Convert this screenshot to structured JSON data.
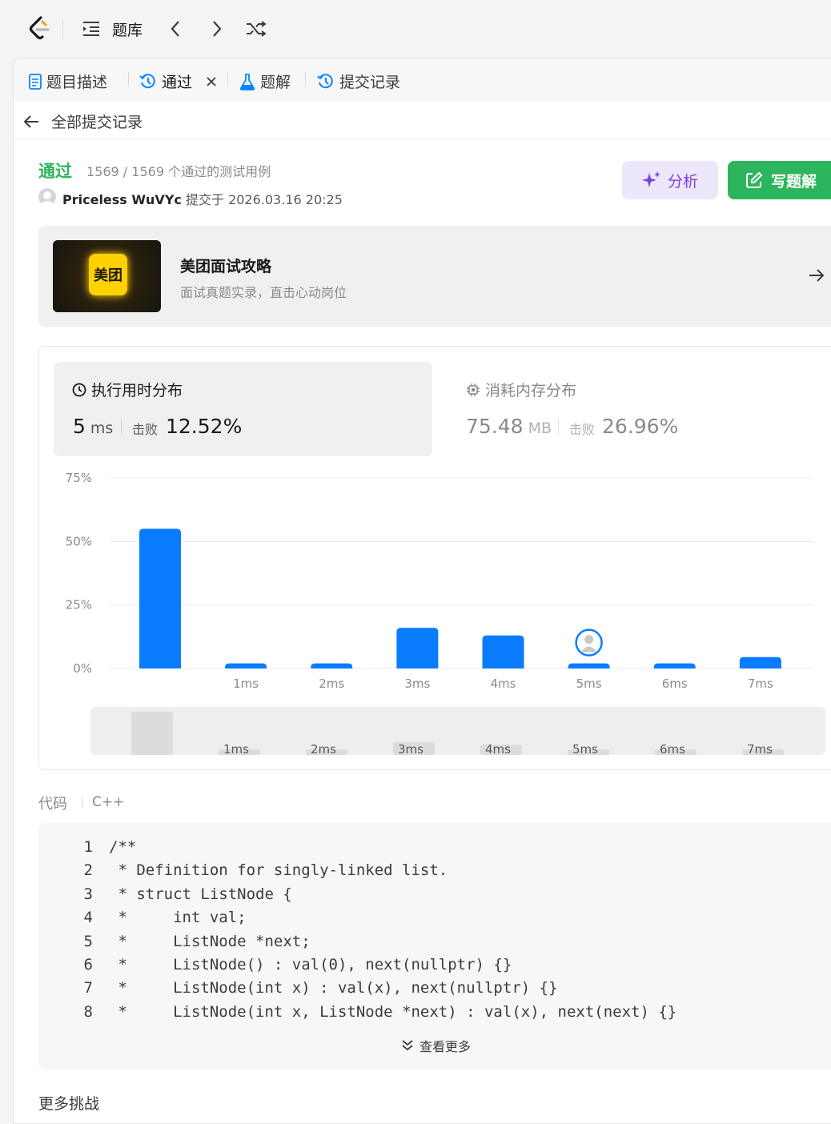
{
  "topbar": {
    "problem_list_label": "题库"
  },
  "tabs": [
    {
      "label": "题目描述",
      "icon": "doc-icon"
    },
    {
      "label": "通过",
      "icon": "history-icon",
      "active": true
    },
    {
      "label": "题解",
      "icon": "flask-icon"
    },
    {
      "label": "提交记录",
      "icon": "history-icon"
    }
  ],
  "back_label": "全部提交记录",
  "submission": {
    "status": "通过",
    "cases": "1569 / 1569 个通过的测试用例",
    "user": "Priceless WuVYc",
    "submitted_text": "提交于 2026.03.16 20:25"
  },
  "actions": {
    "analyze_label": "分析",
    "write_solution_label": "写题解"
  },
  "promo": {
    "badge": "美团",
    "title": "美团面试攻略",
    "subtitle": "面试真题实录，直击心动岗位"
  },
  "runtime": {
    "title": "执行用时分布",
    "value": "5",
    "unit": "ms",
    "beat_label": "击败",
    "beat_value": "12.52%"
  },
  "memory": {
    "title": "消耗内存分布",
    "value": "75.48",
    "unit": "MB",
    "beat_label": "击败",
    "beat_value": "26.96%"
  },
  "chart_data": {
    "type": "bar",
    "categories": [
      "",
      "1ms",
      "2ms",
      "3ms",
      "4ms",
      "5ms",
      "6ms",
      "7ms"
    ],
    "values": [
      55,
      2,
      2,
      16,
      13,
      2,
      2,
      4.5
    ],
    "yticks": [
      "0%",
      "25%",
      "50%",
      "75%"
    ],
    "ylim": [
      0,
      75
    ],
    "highlight_category": "5ms",
    "bar_color": "#0a7cff"
  },
  "code": {
    "label": "代码",
    "language": "C++",
    "lines": [
      {
        "n": "1",
        "text": "/**"
      },
      {
        "n": "2",
        "text": " * Definition for singly-linked list."
      },
      {
        "n": "3",
        "text": " * struct ListNode {"
      },
      {
        "n": "4",
        "text": " *     int val;"
      },
      {
        "n": "5",
        "text": " *     ListNode *next;"
      },
      {
        "n": "6",
        "text": " *     ListNode() : val(0), next(nullptr) {}"
      },
      {
        "n": "7",
        "text": " *     ListNode(int x) : val(x), next(nullptr) {}"
      },
      {
        "n": "8",
        "text": " *     ListNode(int x, ListNode *next) : val(x), next(next) {}"
      }
    ],
    "more_label": "查看更多"
  },
  "more_challenges_label": "更多挑战"
}
